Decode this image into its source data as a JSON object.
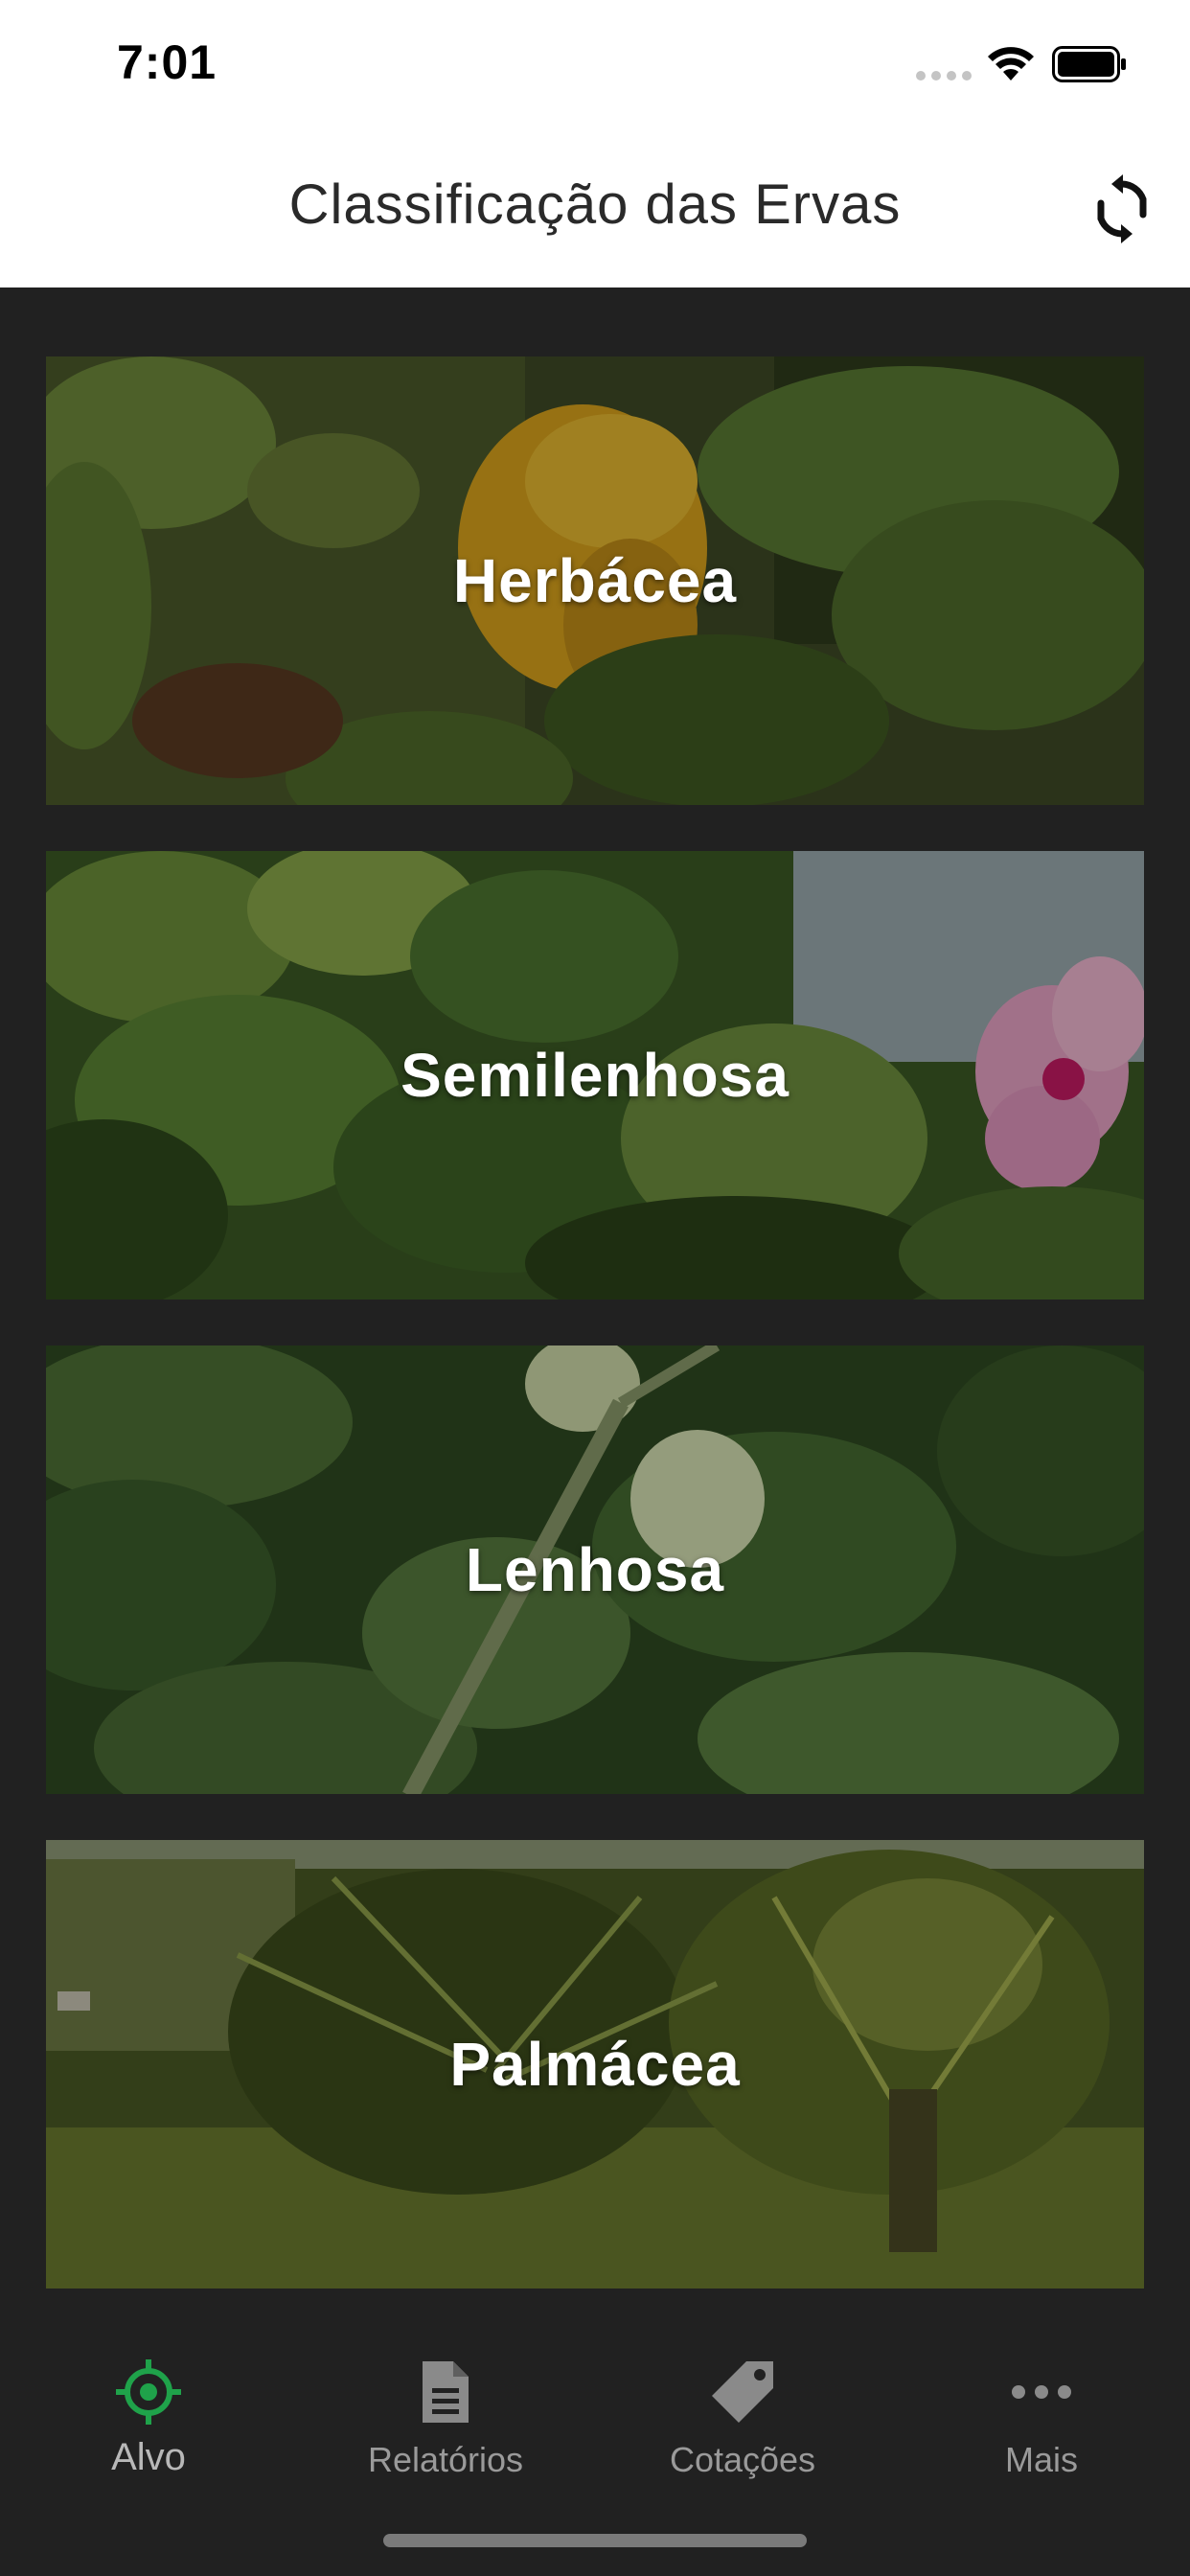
{
  "status_bar": {
    "time": "7:01",
    "icons": [
      "signal-dots-icon",
      "wifi-icon",
      "battery-icon"
    ]
  },
  "header": {
    "title": "Classificação das Ervas",
    "refresh_icon": "refresh-icon"
  },
  "categories": [
    {
      "label": "Herbácea"
    },
    {
      "label": "Semilenhosa"
    },
    {
      "label": "Lenhosa"
    },
    {
      "label": "Palmácea"
    }
  ],
  "tab_bar": {
    "tabs": [
      {
        "label": "Alvo",
        "icon": "target-icon",
        "active": true
      },
      {
        "label": "Relatórios",
        "icon": "document-icon",
        "active": false
      },
      {
        "label": "Cotações",
        "icon": "tag-icon",
        "active": false
      },
      {
        "label": "Mais",
        "icon": "more-icon",
        "active": false
      }
    ]
  },
  "colors": {
    "background": "#212121",
    "header_background": "#ffffff",
    "active_tab": "#1fa24a",
    "inactive_tab": "#9a9a9a"
  }
}
